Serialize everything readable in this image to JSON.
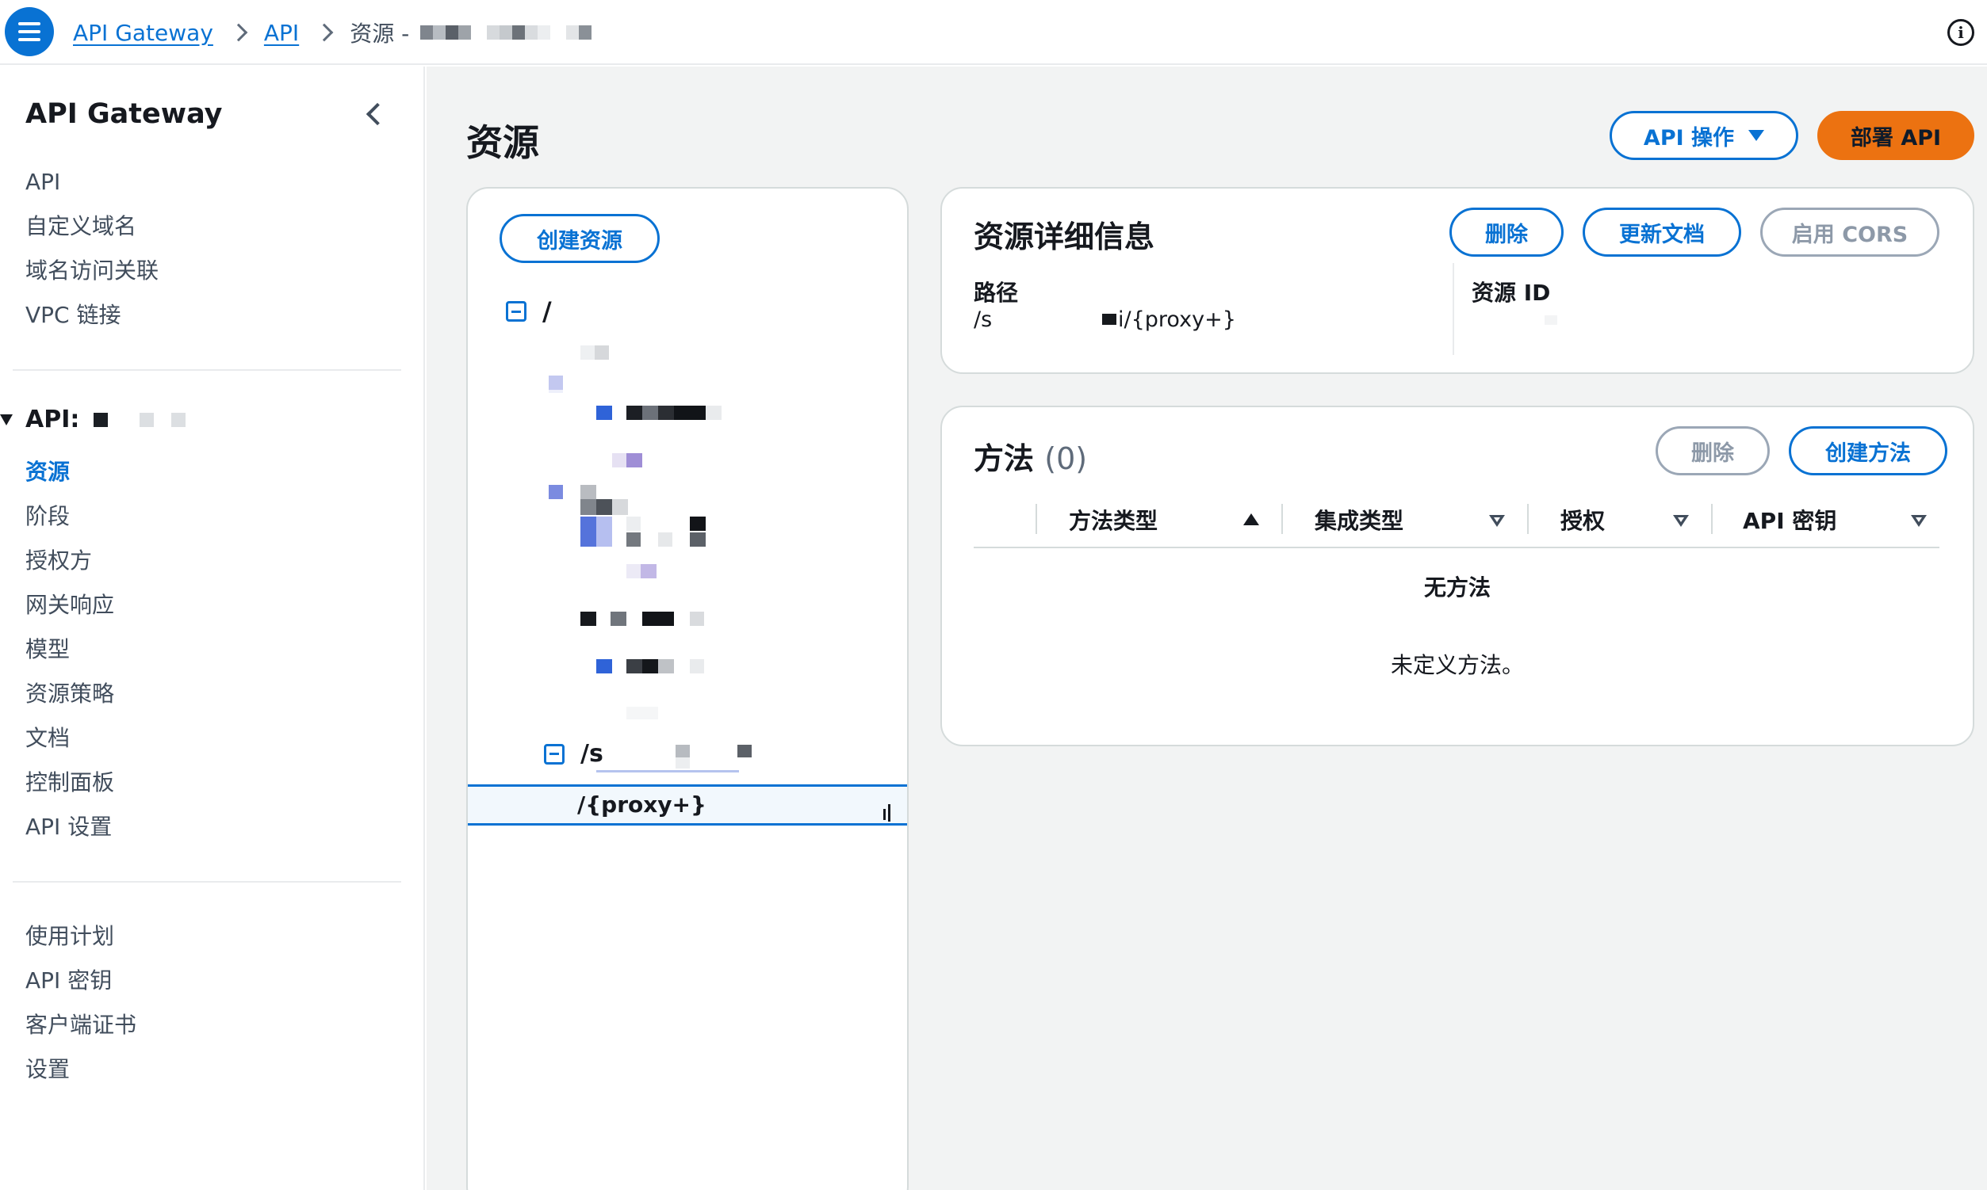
{
  "breadcrumb": {
    "items": [
      "API Gateway",
      "API"
    ],
    "current": "资源 -"
  },
  "sidenav": {
    "title": "API Gateway",
    "top_items": [
      "API",
      "自定义域名",
      "域名访问关联",
      "VPC 链接"
    ],
    "api_section_label": "API:",
    "api_items": [
      "资源",
      "阶段",
      "授权方",
      "网关响应",
      "模型",
      "资源策略",
      "文档",
      "控制面板",
      "API 设置"
    ],
    "bottom_items": [
      "使用计划",
      "API 密钥",
      "客户端证书",
      "设置"
    ],
    "active_item": "资源"
  },
  "page": {
    "title": "资源",
    "api_actions_label": "API 操作",
    "deploy_label": "部署 API"
  },
  "tree": {
    "create_resource_label": "创建资源",
    "root_label": "/",
    "sub_label": "/s",
    "selected_label": "/{proxy+}"
  },
  "details": {
    "title": "资源详细信息",
    "delete_label": "删除",
    "update_doc_label": "更新文档",
    "cors_label": "启用 CORS",
    "path_label": "路径",
    "path_value_prefix": "/s",
    "path_value_suffix": "i/{proxy+}",
    "resource_id_label": "资源 ID"
  },
  "methods": {
    "title": "方法",
    "count": "(0)",
    "delete_label": "删除",
    "create_label": "创建方法",
    "columns": [
      "方法类型",
      "集成类型",
      "授权",
      "API 密钥"
    ],
    "empty_title": "无方法",
    "empty_desc": "未定义方法。"
  },
  "colors": {
    "accent": "#0972d3",
    "primary_button": "#ec7211"
  },
  "icons": [
    "menu-icon",
    "chevron-right-icon",
    "info-icon",
    "chevron-left-icon",
    "caret-down-icon",
    "minus-square-icon",
    "sort-ascending-icon",
    "sort-descending-icon"
  ]
}
